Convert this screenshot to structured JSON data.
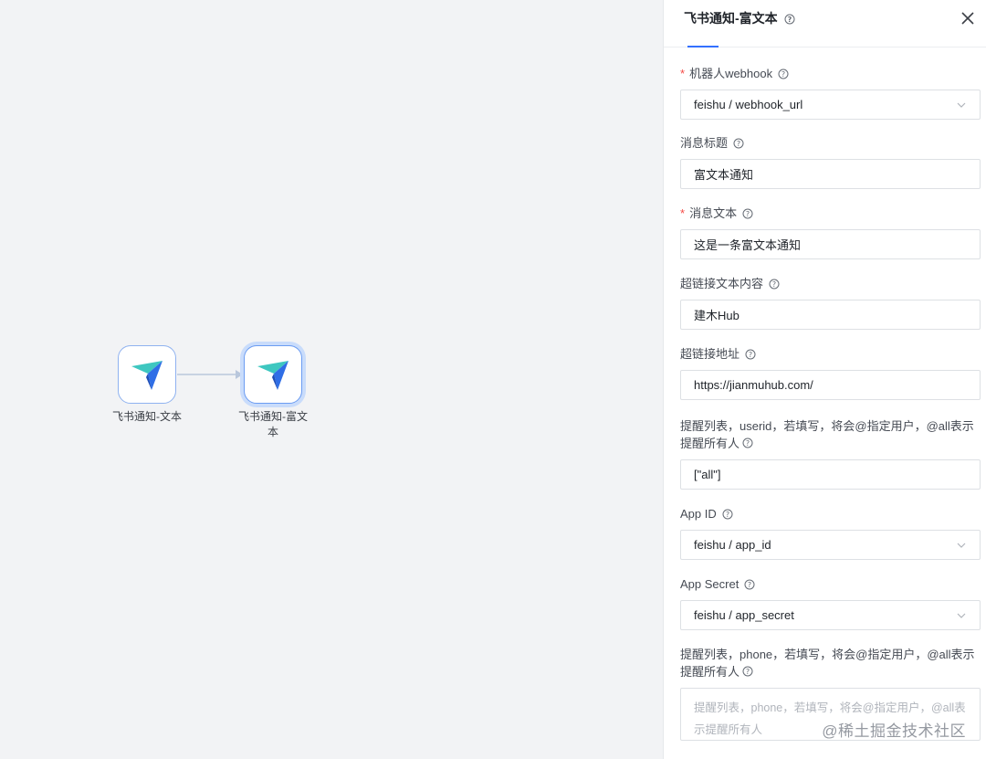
{
  "canvas": {
    "nodes": [
      {
        "label": "飞书通知-文本"
      },
      {
        "label": "飞书通知-富文本"
      }
    ]
  },
  "panel": {
    "title": "飞书通知-富文本",
    "fields": {
      "robot_webhook": {
        "label": "机器人webhook",
        "value": "feishu / webhook_url"
      },
      "msg_title": {
        "label": "消息标题",
        "value": "富文本通知"
      },
      "msg_text": {
        "label": "消息文本",
        "value": "这是一条富文本通知"
      },
      "link_text": {
        "label": "超链接文本内容",
        "value": "建木Hub"
      },
      "link_url": {
        "label": "超链接地址",
        "value": "https://jianmuhub.com/"
      },
      "remind_userid": {
        "label": "提醒列表，userid，若填写，将会@指定用户，@all表示提醒所有人",
        "value": "[\"all\"]"
      },
      "app_id": {
        "label": "App ID",
        "value": "feishu / app_id"
      },
      "app_secret": {
        "label": "App Secret",
        "value": "feishu / app_secret"
      },
      "remind_phone": {
        "label": "提醒列表，phone，若填写，将会@指定用户，@all表示提醒所有人",
        "placeholder": "提醒列表，phone，若填写，将会@指定用户，@all表示提醒所有人"
      }
    }
  },
  "watermark": "@稀土掘金技术社区",
  "colors": {
    "accent": "#3370ff",
    "required": "#f54a45",
    "node_border": "#8fb2f0"
  }
}
